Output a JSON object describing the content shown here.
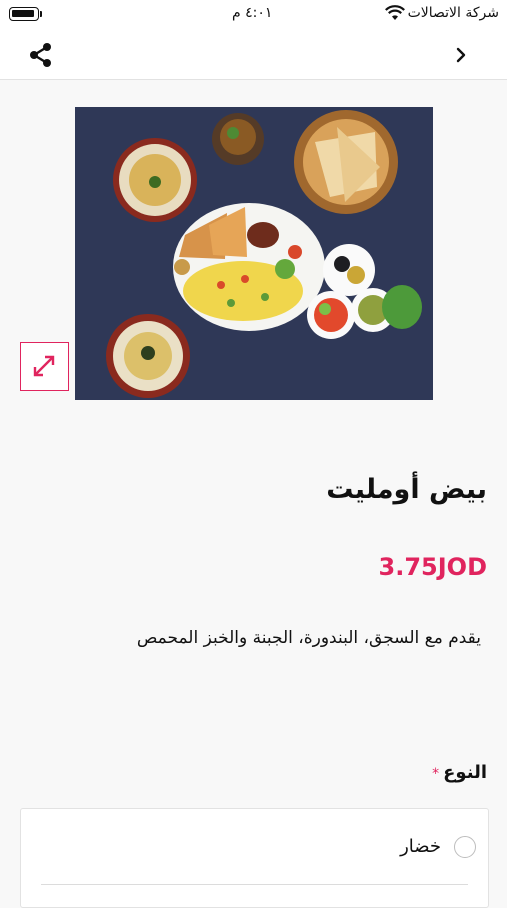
{
  "status_bar": {
    "carrier": "شركة الاتصالات",
    "time": "٤:٠١ م",
    "wifi_icon": "wifi-icon",
    "battery_icon": "battery-icon"
  },
  "nav": {
    "share_icon": "share-icon",
    "back_icon": "chevron-right-icon"
  },
  "product": {
    "image_icon": "expand-icon",
    "title": "بيض أومليت",
    "price": "3.75JOD",
    "description": "يقدم مع السجق، البندورة، الجبنة والخبز المحمص"
  },
  "options": {
    "label": "النوع",
    "required_mark": "*",
    "items": [
      {
        "label": "خضار",
        "selected": false
      }
    ]
  },
  "colors": {
    "accent": "#e0245e",
    "photo_background": "#2c3550"
  }
}
